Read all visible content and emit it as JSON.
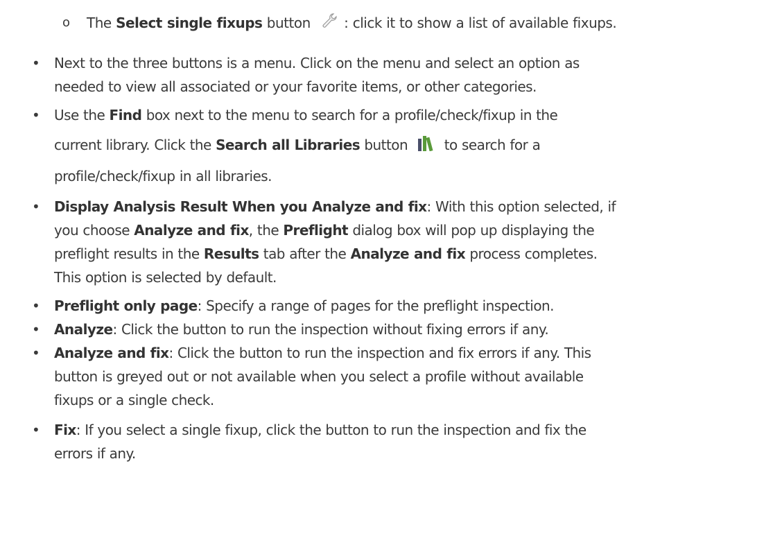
{
  "sub_item": {
    "before": "The ",
    "bold": "Select single fixups",
    "mid": " button ",
    "after": ": click it to show a list of available fixups.",
    "icon": "wrench-icon"
  },
  "bullets": [
    {
      "lines": [
        "Next to the three buttons is a menu. Click on the menu and select an option as",
        "needed to view all associated or your favorite items, or other categories."
      ]
    },
    {
      "l1_a": "Use the ",
      "l1_b": "Find",
      "l1_c": " box next to the menu to search for a profile/check/fixup in the",
      "l2_a": "current library. Click the ",
      "l2_b": "Search all Libraries",
      "l2_c": " button ",
      "l2_d": " to search for a",
      "l3": "profile/check/fixup in all libraries.",
      "icon": "libraries-icon"
    },
    {
      "b1": "Display Analysis Result When you Analyze and fix",
      "t1": ": With this option selected, if",
      "t2": "you choose ",
      "b2": "Analyze and fix",
      "t3": ", the ",
      "b3": "Preflight",
      "t4": " dialog box will pop up displaying the",
      "t5": "preflight results in the ",
      "b4": "Results",
      "t6": " tab after the ",
      "b5": "Analyze and fix",
      "t7": " process completes.",
      "t8": "This option is selected by default."
    },
    {
      "bold": "Preflight only page",
      "text": ": Specify a range of pages for the preflight inspection."
    },
    {
      "bold": "Analyze",
      "text": ": Click the button to run the inspection without fixing errors if any."
    },
    {
      "bold": "Analyze and fix",
      "t1": ": Click the button to run the inspection and fix errors if any. This",
      "t2": "button is greyed out or not available when you select a profile without available",
      "t3": "fixups or a single check."
    },
    {
      "bold": "Fix",
      "t1": ": If you select a single fixup, click the button to run the inspection and fix the",
      "t2": "errors if any."
    }
  ],
  "markers": {
    "bullet": "•",
    "circle": "o"
  },
  "colors": {
    "text": "#3a3a3a",
    "icon_green": "#5a9a3a",
    "icon_dark": "#4a4f6a"
  }
}
